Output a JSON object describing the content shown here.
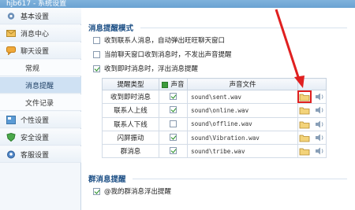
{
  "window": {
    "title": "hjb617 - 系统设置"
  },
  "sidebar": {
    "items": [
      {
        "label": "基本设置",
        "icon": "gear-icon",
        "type": "group"
      },
      {
        "label": "消息中心",
        "icon": "envelope-icon",
        "type": "group"
      },
      {
        "label": "聊天设置",
        "icon": "chat-icon",
        "type": "group"
      },
      {
        "label": "常规",
        "type": "sub"
      },
      {
        "label": "消息提醒",
        "type": "sub",
        "active": true
      },
      {
        "label": "文件记录",
        "type": "sub"
      },
      {
        "label": "个性设置",
        "icon": "palette-icon",
        "type": "group"
      },
      {
        "label": "安全设置",
        "icon": "shield-icon",
        "type": "group"
      },
      {
        "label": "客服设置",
        "icon": "headset-icon",
        "type": "group"
      }
    ]
  },
  "main": {
    "section1_title": "消息提醒模式",
    "options": [
      {
        "label": "收到联系人消息，自动弹出旺旺聊天窗口",
        "checked": false
      },
      {
        "label": "当前聊天窗口收到消息时，不发出声音提醒",
        "checked": false
      },
      {
        "label": "收到即时消息时，浮出消息提醒",
        "checked": true
      }
    ],
    "table": {
      "headers": {
        "type": "提醒类型",
        "sound": "声音",
        "file": "声音文件"
      },
      "rows": [
        {
          "type": "收到即时消息",
          "sound": true,
          "file": "sound\\sent.wav"
        },
        {
          "type": "联系人上线",
          "sound": true,
          "file": "sound\\online.wav"
        },
        {
          "type": "联系人下线",
          "sound": false,
          "file": "sound\\offline.wav"
        },
        {
          "type": "闪屏振动",
          "sound": true,
          "file": "sound\\Vibration.wav"
        },
        {
          "type": "群消息",
          "sound": true,
          "file": "sound\\tribe.wav"
        }
      ]
    },
    "section2_title": "群消息提醒",
    "group_option": {
      "label": "@我的群消息浮出提醒",
      "checked": true
    }
  },
  "colors": {
    "accent": "#1a4d84",
    "highlight": "#e02020",
    "check": "#1e8c1e"
  }
}
